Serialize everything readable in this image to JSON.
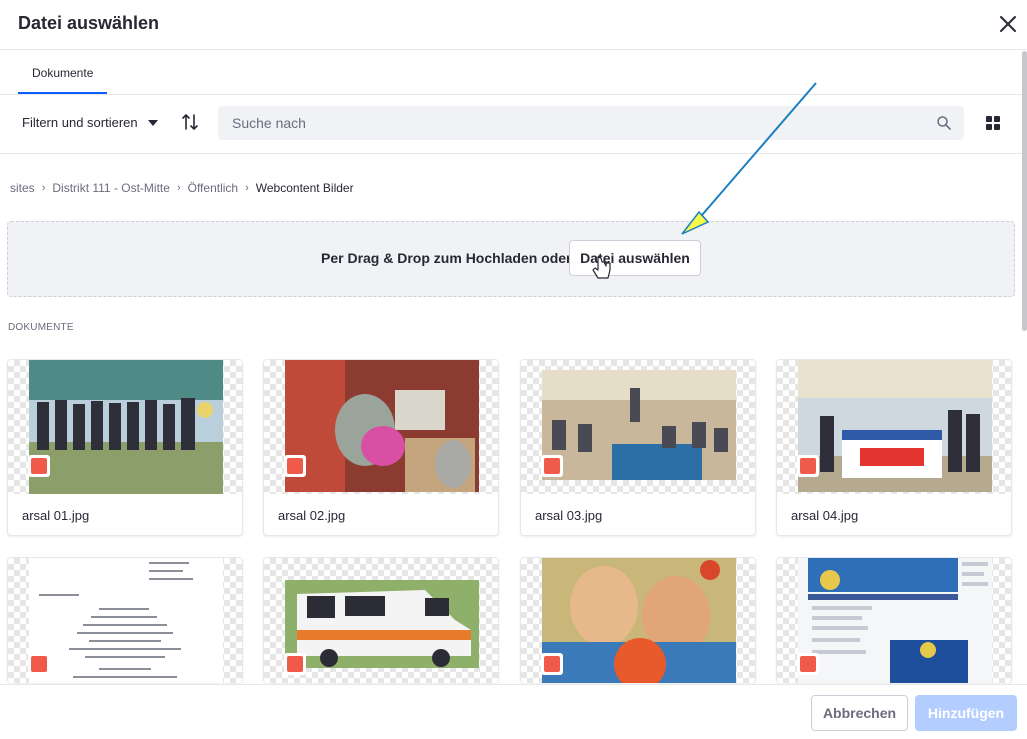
{
  "dialog": {
    "title": "Datei auswählen"
  },
  "tabs": [
    {
      "label": "Dokumente"
    }
  ],
  "toolbar": {
    "filter_label": "Filtern und sortieren",
    "search_placeholder": "Suche nach"
  },
  "breadcrumb": [
    {
      "label": "sites"
    },
    {
      "label": "Distrikt 111 - Ost-Mitte"
    },
    {
      "label": "Öffentlich"
    },
    {
      "label": "Webcontent Bilder"
    }
  ],
  "dropzone": {
    "text": "Per Drag & Drop zum Hochladen oder",
    "button_label": "Datei auswählen"
  },
  "section_title": "DOKUMENTE",
  "documents": [
    {
      "name": "arsal 01.jpg"
    },
    {
      "name": "arsal 02.jpg"
    },
    {
      "name": "arsal 03.jpg"
    },
    {
      "name": "arsal 04.jpg"
    },
    {
      "name": ""
    },
    {
      "name": ""
    },
    {
      "name": ""
    },
    {
      "name": ""
    }
  ],
  "footer": {
    "cancel_label": "Abbrechen",
    "add_label": "Hinzufügen"
  },
  "colors": {
    "accent": "#0b5fff",
    "add_disabled": "#b3cdff",
    "file_badge": "#f05a4a",
    "annotation_arrow": "#1a7fc1",
    "annotation_arrow_head": "#f4f94a"
  },
  "icons": [
    "close-icon",
    "caret-down-icon",
    "sort-icon",
    "search-icon",
    "grid-view-icon",
    "image-file-icon",
    "hand-cursor-icon",
    "annotation-arrow"
  ]
}
